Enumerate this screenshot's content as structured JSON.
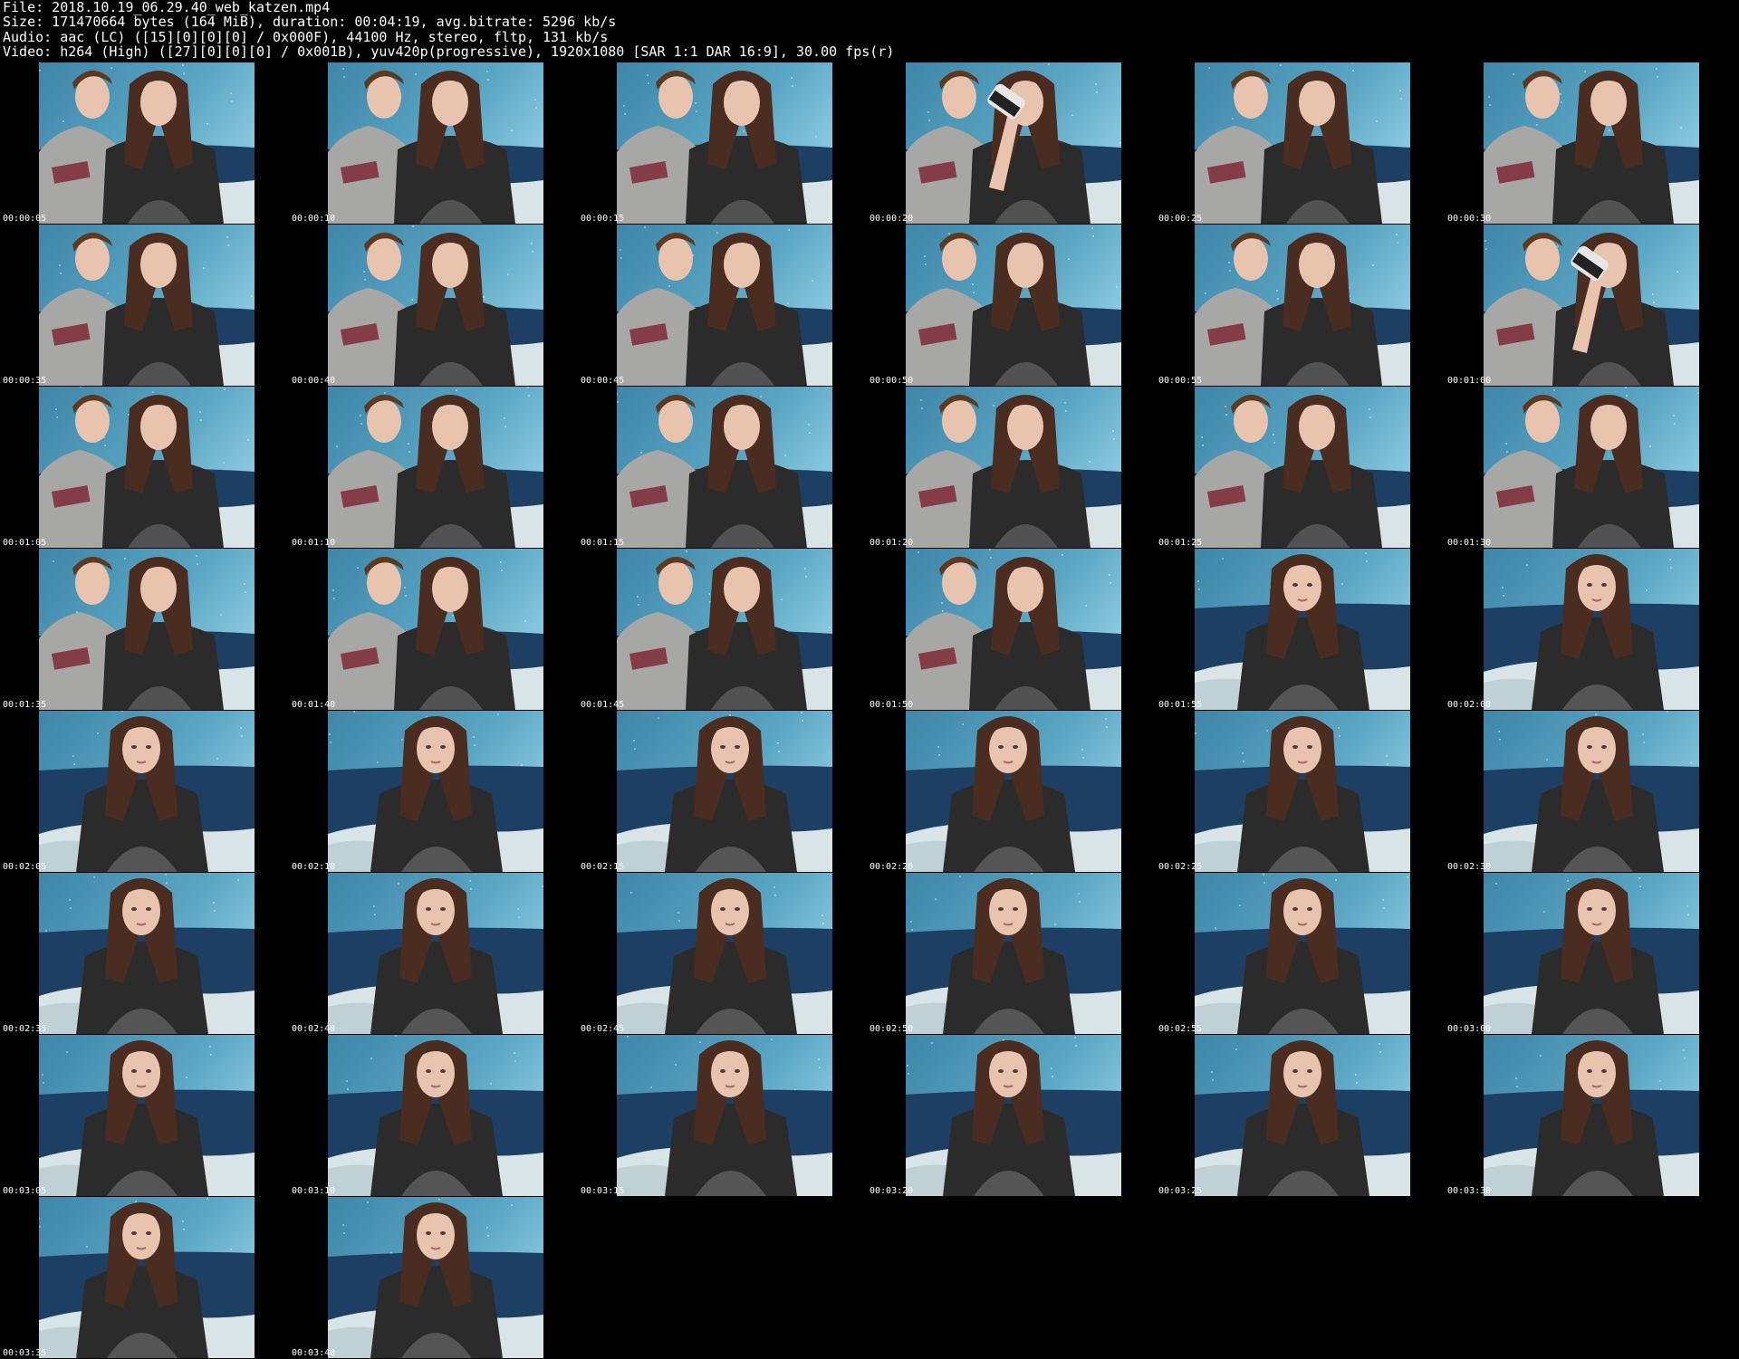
{
  "header": {
    "lines": [
      "File: 2018.10.19_06.29.40_web_katzen.mp4",
      "Size: 171470664 bytes (164 MiB), duration: 00:04:19, avg.bitrate: 5296 kb/s",
      "Audio: aac (LC) ([15][0][0][0] / 0x000F), 44100 Hz, stereo, fltp, 131 kb/s",
      "Video: h264 (High) ([27][0][0][0] / 0x001B), yuv420p(progressive), 1920x1080 [SAR 1:1 DAR 16:9], 30.00 fps(r)"
    ]
  },
  "thumbnails": [
    {
      "timestamp": "00:00:05",
      "scene": "couple"
    },
    {
      "timestamp": "00:00:10",
      "scene": "couple"
    },
    {
      "timestamp": "00:00:15",
      "scene": "couple"
    },
    {
      "timestamp": "00:00:20",
      "scene": "couple-drinking"
    },
    {
      "timestamp": "00:00:25",
      "scene": "couple"
    },
    {
      "timestamp": "00:00:30",
      "scene": "couple"
    },
    {
      "timestamp": "00:00:35",
      "scene": "couple"
    },
    {
      "timestamp": "00:00:40",
      "scene": "couple"
    },
    {
      "timestamp": "00:00:45",
      "scene": "couple"
    },
    {
      "timestamp": "00:00:50",
      "scene": "couple"
    },
    {
      "timestamp": "00:00:55",
      "scene": "couple"
    },
    {
      "timestamp": "00:01:00",
      "scene": "couple-drinking"
    },
    {
      "timestamp": "00:01:05",
      "scene": "couple"
    },
    {
      "timestamp": "00:01:10",
      "scene": "couple"
    },
    {
      "timestamp": "00:01:15",
      "scene": "couple"
    },
    {
      "timestamp": "00:01:20",
      "scene": "couple"
    },
    {
      "timestamp": "00:01:25",
      "scene": "couple"
    },
    {
      "timestamp": "00:01:30",
      "scene": "couple"
    },
    {
      "timestamp": "00:01:35",
      "scene": "couple"
    },
    {
      "timestamp": "00:01:40",
      "scene": "couple"
    },
    {
      "timestamp": "00:01:45",
      "scene": "couple"
    },
    {
      "timestamp": "00:01:50",
      "scene": "couple"
    },
    {
      "timestamp": "00:01:55",
      "scene": "solo"
    },
    {
      "timestamp": "00:02:00",
      "scene": "solo"
    },
    {
      "timestamp": "00:02:05",
      "scene": "solo"
    },
    {
      "timestamp": "00:02:10",
      "scene": "solo"
    },
    {
      "timestamp": "00:02:15",
      "scene": "solo"
    },
    {
      "timestamp": "00:02:20",
      "scene": "solo"
    },
    {
      "timestamp": "00:02:25",
      "scene": "solo"
    },
    {
      "timestamp": "00:02:30",
      "scene": "solo"
    },
    {
      "timestamp": "00:02:35",
      "scene": "solo"
    },
    {
      "timestamp": "00:02:40",
      "scene": "solo"
    },
    {
      "timestamp": "00:02:45",
      "scene": "solo"
    },
    {
      "timestamp": "00:02:50",
      "scene": "solo"
    },
    {
      "timestamp": "00:02:55",
      "scene": "solo"
    },
    {
      "timestamp": "00:03:00",
      "scene": "solo"
    },
    {
      "timestamp": "00:03:05",
      "scene": "solo"
    },
    {
      "timestamp": "00:03:10",
      "scene": "solo"
    },
    {
      "timestamp": "00:03:15",
      "scene": "solo"
    },
    {
      "timestamp": "00:03:20",
      "scene": "solo"
    },
    {
      "timestamp": "00:03:25",
      "scene": "solo"
    },
    {
      "timestamp": "00:03:30",
      "scene": "solo"
    },
    {
      "timestamp": "00:03:35",
      "scene": "solo"
    },
    {
      "timestamp": "00:03:40",
      "scene": "solo"
    }
  ],
  "colors": {
    "background": "#000000",
    "text": "#ffffff",
    "backdrop_blue": "#3f86a8",
    "backdrop_light": "#8fcde0",
    "couch_blue": "#1d3f63",
    "shirt_dark": "#2b2b2b",
    "shirt_grey": "#a7a7a5",
    "hair_brown": "#4a2d20",
    "skin": "#e8c3ae",
    "bed_white": "#d9e4e6"
  }
}
